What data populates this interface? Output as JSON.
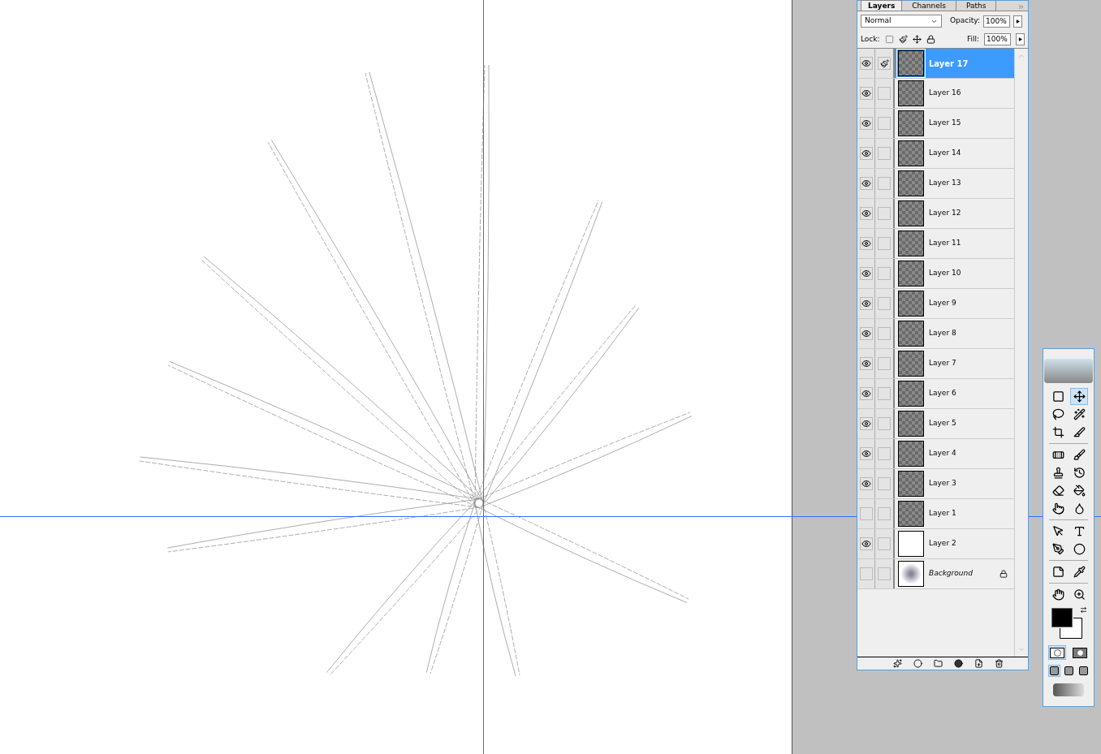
{
  "layers_panel": {
    "tabs": [
      {
        "label": "Layers",
        "selected": true
      },
      {
        "label": "Channels",
        "selected": false
      },
      {
        "label": "Paths",
        "selected": false
      }
    ],
    "blend_mode": "Normal",
    "opacity_label": "Opacity:",
    "opacity": "100%",
    "lock_label": "Lock:",
    "fill_label": "Fill:",
    "fill": "100%",
    "layers": [
      {
        "name": "Layer 17",
        "visible": true,
        "selected": true,
        "kind": "transparent",
        "locked": false
      },
      {
        "name": "Layer 16",
        "visible": true,
        "selected": false,
        "kind": "transparent",
        "locked": false
      },
      {
        "name": "Layer 15",
        "visible": true,
        "selected": false,
        "kind": "transparent",
        "locked": false
      },
      {
        "name": "Layer 14",
        "visible": true,
        "selected": false,
        "kind": "transparent",
        "locked": false
      },
      {
        "name": "Layer 13",
        "visible": true,
        "selected": false,
        "kind": "transparent",
        "locked": false
      },
      {
        "name": "Layer 12",
        "visible": true,
        "selected": false,
        "kind": "transparent",
        "locked": false
      },
      {
        "name": "Layer 11",
        "visible": true,
        "selected": false,
        "kind": "transparent",
        "locked": false
      },
      {
        "name": "Layer 10",
        "visible": true,
        "selected": false,
        "kind": "transparent",
        "locked": false
      },
      {
        "name": "Layer 9",
        "visible": true,
        "selected": false,
        "kind": "transparent",
        "locked": false
      },
      {
        "name": "Layer 8",
        "visible": true,
        "selected": false,
        "kind": "transparent",
        "locked": false
      },
      {
        "name": "Layer 7",
        "visible": true,
        "selected": false,
        "kind": "transparent",
        "locked": false
      },
      {
        "name": "Layer 6",
        "visible": true,
        "selected": false,
        "kind": "transparent",
        "locked": false
      },
      {
        "name": "Layer 5",
        "visible": true,
        "selected": false,
        "kind": "transparent",
        "locked": false
      },
      {
        "name": "Layer 4",
        "visible": true,
        "selected": false,
        "kind": "transparent",
        "locked": false
      },
      {
        "name": "Layer 3",
        "visible": true,
        "selected": false,
        "kind": "transparent",
        "locked": false
      },
      {
        "name": "Layer 1",
        "visible": false,
        "selected": false,
        "kind": "transparent",
        "locked": false
      },
      {
        "name": "Layer 2",
        "visible": true,
        "selected": false,
        "kind": "white",
        "locked": false
      },
      {
        "name": "Background",
        "visible": false,
        "selected": false,
        "kind": "image",
        "locked": true
      }
    ]
  },
  "toolbox": {
    "tools": [
      {
        "kind": "marquee",
        "selected": false
      },
      {
        "kind": "move",
        "selected": true
      },
      {
        "kind": "lasso",
        "selected": false
      },
      {
        "kind": "wand",
        "selected": false
      },
      {
        "kind": "crop",
        "selected": false
      },
      {
        "kind": "slice",
        "selected": false
      },
      {
        "kind": "heal",
        "selected": false
      },
      {
        "kind": "brush",
        "selected": false
      },
      {
        "kind": "stamp",
        "selected": false
      },
      {
        "kind": "history",
        "selected": false
      },
      {
        "kind": "eraser",
        "selected": false
      },
      {
        "kind": "bucket",
        "selected": false
      },
      {
        "kind": "smudge",
        "selected": false
      },
      {
        "kind": "dodge",
        "selected": false
      },
      {
        "kind": "select",
        "selected": false
      },
      {
        "kind": "type",
        "selected": false
      },
      {
        "kind": "pen",
        "selected": false
      },
      {
        "kind": "shape",
        "selected": false
      },
      {
        "kind": "notes",
        "selected": false
      },
      {
        "kind": "eyedropper",
        "selected": false
      },
      {
        "kind": "hand",
        "selected": false
      },
      {
        "kind": "zoom",
        "selected": false
      }
    ],
    "modes": [
      {
        "selected": true
      },
      {
        "selected": false
      }
    ],
    "screens": [
      {
        "selected": true
      },
      {
        "selected": false
      },
      {
        "selected": false
      }
    ]
  }
}
